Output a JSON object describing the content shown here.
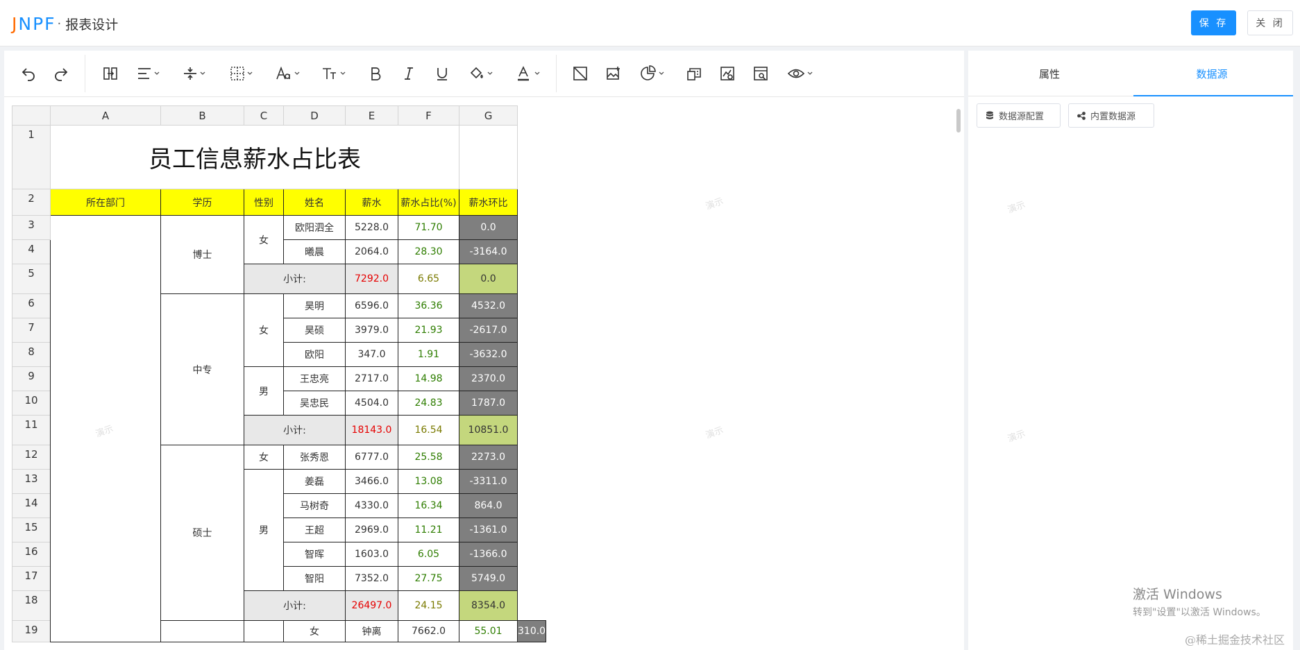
{
  "header": {
    "logo_text": "JNPF",
    "logo_separator": "·",
    "page_title": "报表设计",
    "save_label": "保 存",
    "close_label": "关 闭"
  },
  "toolbar": {
    "icons": [
      "undo-icon",
      "redo-icon",
      "merge-cells-icon",
      "align-horizontal-icon",
      "align-vertical-icon",
      "border-icon",
      "font-family-icon",
      "font-size-icon",
      "bold-icon",
      "italic-icon",
      "underline-icon",
      "fill-color-icon",
      "font-color-icon",
      "slash-header-icon",
      "insert-image-icon",
      "insert-chart-icon",
      "insert-barcode-icon",
      "insert-qrcode-icon",
      "preview-print-icon",
      "preview-icon"
    ]
  },
  "sheet": {
    "col_headers": [
      "A",
      "B",
      "C",
      "D",
      "E",
      "F",
      "G"
    ],
    "row_headers": [
      "1",
      "2",
      "3",
      "4",
      "5",
      "6",
      "7",
      "8",
      "9",
      "10",
      "11",
      "12",
      "13",
      "14",
      "15",
      "16",
      "17",
      "18",
      "19"
    ],
    "title": "员工信息薪水占比表",
    "headers": [
      "所在部门",
      "学历",
      "性别",
      "姓名",
      "薪水",
      "薪水占比(%)",
      "薪水环比"
    ],
    "groups": {
      "edu_phd": "博士",
      "edu_zz": "中专",
      "edu_ss": "硕士",
      "female": "女",
      "male": "男",
      "subtotal": "小计:"
    },
    "rows": {
      "r3": {
        "name": "欧阳泗全",
        "salary": "5228.0",
        "pct": "71.70",
        "ring": "0.0"
      },
      "r4": {
        "name": "曦晨",
        "salary": "2064.0",
        "pct": "28.30",
        "ring": "-3164.0"
      },
      "r5": {
        "salary": "7292.0",
        "pct": "6.65",
        "ring": "0.0"
      },
      "r6": {
        "name": "昊明",
        "salary": "6596.0",
        "pct": "36.36",
        "ring": "4532.0"
      },
      "r7": {
        "name": "昊硕",
        "salary": "3979.0",
        "pct": "21.93",
        "ring": "-2617.0"
      },
      "r8": {
        "name": "欧阳",
        "salary": "347.0",
        "pct": "1.91",
        "ring": "-3632.0"
      },
      "r9": {
        "name": "王忠亮",
        "salary": "2717.0",
        "pct": "14.98",
        "ring": "2370.0"
      },
      "r10": {
        "name": "吴忠民",
        "salary": "4504.0",
        "pct": "24.83",
        "ring": "1787.0"
      },
      "r11": {
        "salary": "18143.0",
        "pct": "16.54",
        "ring": "10851.0"
      },
      "r12": {
        "name": "张秀恩",
        "salary": "6777.0",
        "pct": "25.58",
        "ring": "2273.0"
      },
      "r13": {
        "name": "姜磊",
        "salary": "3466.0",
        "pct": "13.08",
        "ring": "-3311.0"
      },
      "r14": {
        "name": "马树奇",
        "salary": "4330.0",
        "pct": "16.34",
        "ring": "864.0"
      },
      "r15": {
        "name": "王超",
        "salary": "2969.0",
        "pct": "11.21",
        "ring": "-1361.0"
      },
      "r16": {
        "name": "智晖",
        "salary": "1603.0",
        "pct": "6.05",
        "ring": "-1366.0"
      },
      "r17": {
        "name": "智阳",
        "salary": "7352.0",
        "pct": "27.75",
        "ring": "5749.0"
      },
      "r18": {
        "salary": "26497.0",
        "pct": "24.15",
        "ring": "8354.0"
      },
      "r19": {
        "name": "钟离",
        "salary": "7662.0",
        "pct": "55.01",
        "ring": "310.0"
      }
    },
    "watermark": "演示"
  },
  "right_panel": {
    "tabs": [
      "属性",
      "数据源"
    ],
    "active_tab": "数据源",
    "btn_config": "数据源配置",
    "btn_builtin": "内置数据源"
  },
  "windows_activation": {
    "line1": "激活 Windows",
    "line2": "转到\"设置\"以激活 Windows。"
  },
  "credit": "@稀土掘金技术社区",
  "colors": {
    "primary": "#1890ff",
    "header_yellow": "#ffff00",
    "ring_dark": "#7f7f7f",
    "subtotal_lime": "#c4d77d",
    "subtotal_red": "#e60000",
    "pct_green": "#2e7d00"
  }
}
